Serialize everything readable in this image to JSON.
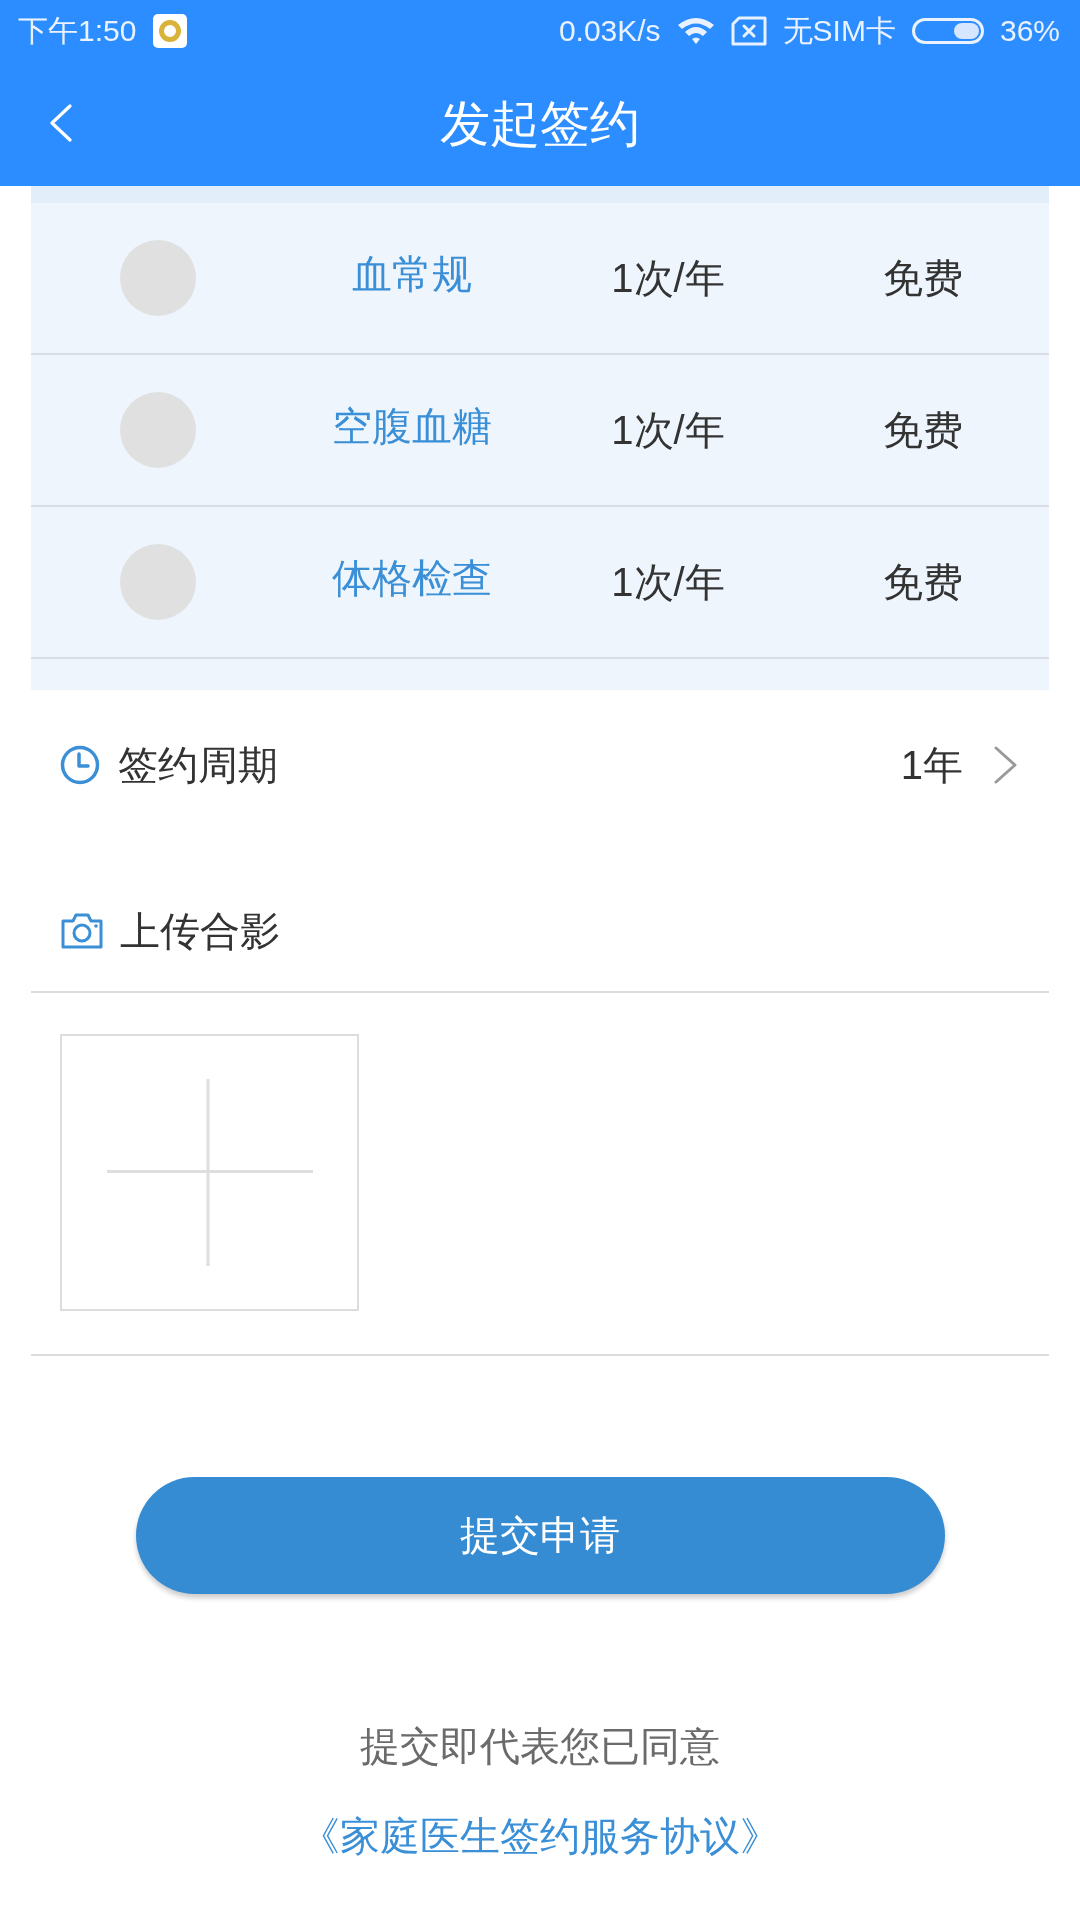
{
  "status_bar": {
    "time": "下午1:50",
    "net_speed": "0.03K/s",
    "sim": "无SIM卡",
    "battery": "36%"
  },
  "nav_bar": {
    "title": "发起签约"
  },
  "services": [
    {
      "name": "血常规",
      "frequency": "1次/年",
      "fee": "免费"
    },
    {
      "name": "空腹血糖",
      "frequency": "1次/年",
      "fee": "免费"
    },
    {
      "name": "体格检查",
      "frequency": "1次/年",
      "fee": "免费"
    }
  ],
  "sign_period": {
    "label": "签约周期",
    "value": "1年"
  },
  "upload_photo": {
    "label": "上传合影"
  },
  "submit_button": {
    "label": "提交申请"
  },
  "agreement": {
    "notice": "提交即代表您已同意",
    "link": "《家庭医生签约服务协议》"
  }
}
